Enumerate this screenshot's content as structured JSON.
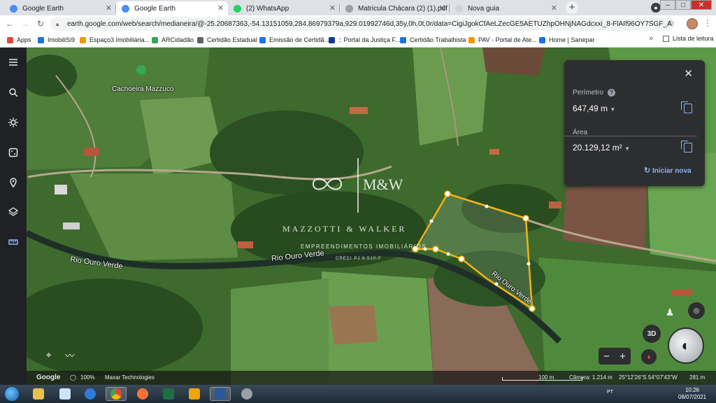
{
  "browser": {
    "tabs": [
      {
        "title": "Google Earth",
        "favicon_color": "#4c8bf5",
        "active": false
      },
      {
        "title": "Google Earth",
        "favicon_color": "#4c8bf5",
        "active": true
      },
      {
        "title": "(2) WhatsApp",
        "favicon_color": "#25d366",
        "active": false
      },
      {
        "title": "Matricula Chácara (2) (1).pdf",
        "favicon_color": "#9aa0a6",
        "active": false
      },
      {
        "title": "Nova guia",
        "favicon_color": "#dee1e6",
        "active": false
      }
    ],
    "url": "earth.google.com/web/search/medianeira/@-25.20687363,-54.13151059,284.86979379a,929.01992746d,35y,0h,0t,0r/data=CigiJgokCfAeLZecGE5AETUZhpOHNjNAGdcxxi_8-FlAIf96OY7SGF_A",
    "bookmarks": [
      {
        "label": "Apps",
        "color": "#ea4335"
      },
      {
        "label": "ImobiliSi9",
        "color": "#1a73e8"
      },
      {
        "label": "Espaço3 Imobiliária...",
        "color": "#f29900"
      },
      {
        "label": "ARCidadão",
        "color": "#34a853"
      },
      {
        "label": "Certidão Estadual",
        "color": "#5f6368"
      },
      {
        "label": "Emissão de Certidã...",
        "color": "#1a73e8"
      },
      {
        "label": ":: Portal da Justiça F...",
        "color": "#0b3d91"
      },
      {
        "label": "Certidão Trabalhista",
        "color": "#1a73e8"
      },
      {
        "label": "PAV - Portal de Ate...",
        "color": "#f29900"
      },
      {
        "label": "Home | Sanepar",
        "color": "#1a73e8"
      }
    ],
    "bookmarks_more": "»",
    "reading_list": "Lista de leitura"
  },
  "earth": {
    "place_label": "Cachoeira Mazzuco",
    "river_labels": [
      "Rio Ouro Verde",
      "Rio Ouro Verde",
      "Rio Ouro Verde"
    ],
    "watermark": {
      "brand": "M&W",
      "name": "MAZZOTTI & WALKER",
      "subtitle": "EMPREENDIMENTOS IMOBILIÁRIOS",
      "creci": "CRECI PJ 8.510-F"
    },
    "measure_panel": {
      "perimeter_label": "Perímetro",
      "perimeter_value": "647,49 m",
      "area_label": "Área",
      "area_value": "20.129,12 m²",
      "restart_label": "Iniciar nova",
      "close_label": "✕"
    },
    "status": {
      "google": "Google",
      "loaded": "100%",
      "credit": "Maxar Technologies",
      "scale": "100 m",
      "camera": "Câmera: 1.214 m",
      "coords": "25°12'26\"S 54°07'43\"W",
      "elevation": "281 m"
    },
    "mode_3d": "3D",
    "zoom_out": "−",
    "zoom_in": "+"
  },
  "taskbar": {
    "time": "10:26",
    "date": "08/07/2021",
    "tray": "PT"
  }
}
